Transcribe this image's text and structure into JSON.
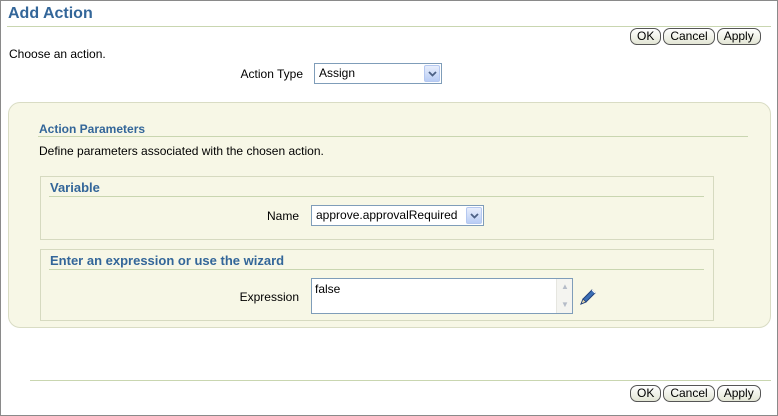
{
  "header": {
    "title": "Add Action"
  },
  "buttons": {
    "ok": "OK",
    "cancel": "Cancel",
    "apply": "Apply"
  },
  "intro": {
    "instruction": "Choose an action."
  },
  "action_type": {
    "label": "Action Type",
    "value": "Assign"
  },
  "action_parameters": {
    "title": "Action Parameters",
    "instruction": "Define parameters associated with the chosen action."
  },
  "variable": {
    "title": "Variable",
    "name_label": "Name",
    "name_value": "approve.approvalRequired"
  },
  "expression": {
    "title": "Enter an expression or use the wizard",
    "label": "Expression",
    "value": "false"
  },
  "icons": {
    "dropdown": "chevron-down-icon",
    "wizard": "pencil-icon",
    "scroll_up": "scroll-up-icon",
    "scroll_down": "scroll-down-icon"
  },
  "colors": {
    "header_text": "#336699",
    "panel_bg": "#f7f7e6",
    "rule": "#c9d6b0"
  }
}
